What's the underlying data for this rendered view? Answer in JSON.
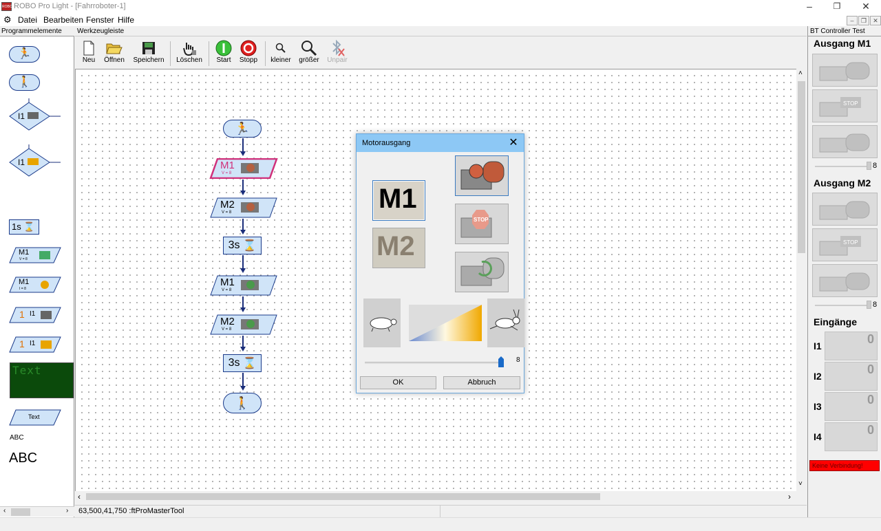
{
  "window": {
    "title": "ROBO Pro Light - [Fahrroboter-1]",
    "min": "–",
    "max": "❐",
    "close": "✕"
  },
  "menu": [
    {
      "label": "Datei"
    },
    {
      "label": "Bearbeiten"
    },
    {
      "label": "Fenster"
    },
    {
      "label": "Hilfe"
    }
  ],
  "left_panel": {
    "title": "Programmelemente",
    "text_label": "Text",
    "abc_small": "ABC",
    "abc_large": "ABC",
    "display_text": "Text",
    "items": {
      "i1": "I1",
      "wait": "1s",
      "m1": "M1",
      "m1_sub": "V = 8",
      "m1b": "M1",
      "m1b_sub": "I = 8",
      "cnt1": "1",
      "cnt1_i": "I1",
      "cnt2": "1",
      "cnt2_i": "I1"
    }
  },
  "toolbar": {
    "title": "Werkzeugleiste",
    "buttons": [
      {
        "label": "Neu"
      },
      {
        "label": "Öffnen"
      },
      {
        "label": "Speichern"
      },
      {
        "label": "Löschen"
      },
      {
        "label": "Start"
      },
      {
        "label": "Stopp"
      },
      {
        "label": "kleiner"
      },
      {
        "label": "größer"
      },
      {
        "label": "Unpair"
      }
    ]
  },
  "flow": [
    {
      "type": "start"
    },
    {
      "type": "motor",
      "label": "M1",
      "sub": "V = 8"
    },
    {
      "type": "motor",
      "label": "M2",
      "sub": "V = 8"
    },
    {
      "type": "wait",
      "label": "3s"
    },
    {
      "type": "motor",
      "label": "M1",
      "sub": "V = 8"
    },
    {
      "type": "motor",
      "label": "M2",
      "sub": "V = 8"
    },
    {
      "type": "wait",
      "label": "3s"
    },
    {
      "type": "end"
    }
  ],
  "status": {
    "text": "63,500,41,750 :ftProMasterTool"
  },
  "right_panel": {
    "title": "BT Controller Test",
    "out1": "Ausgang M1",
    "out1_val": "8",
    "out2": "Ausgang M2",
    "out2_val": "8",
    "inputs_title": "Eingänge",
    "inputs": [
      {
        "label": "I1",
        "value": "0"
      },
      {
        "label": "I2",
        "value": "0"
      },
      {
        "label": "I3",
        "value": "0"
      },
      {
        "label": "I4",
        "value": "0"
      }
    ],
    "connection": "Keine Verbindung!"
  },
  "dialog": {
    "title": "Motorausgang",
    "m1": "M1",
    "m2": "M2",
    "speed_value": "8",
    "ok": "OK",
    "cancel": "Abbruch"
  },
  "colors": {
    "accent_blue": "#1a2d7a",
    "selected_magenta": "#d0307a",
    "dialog_title": "#8dc8f5",
    "no_connection": "#ff0000"
  }
}
